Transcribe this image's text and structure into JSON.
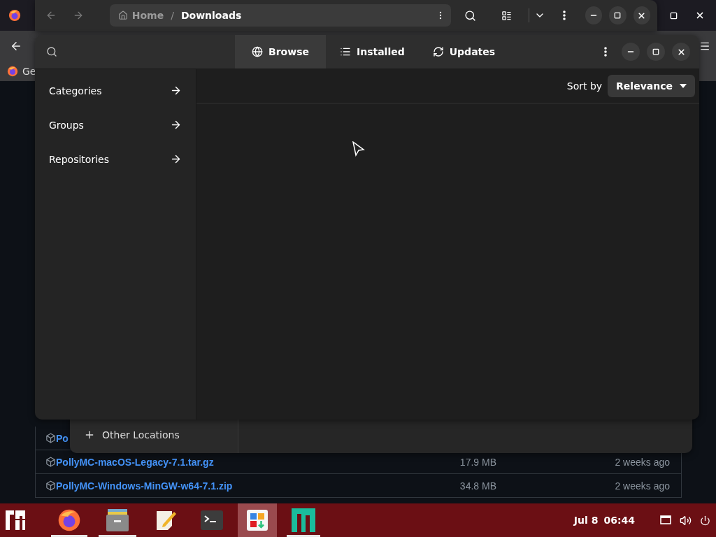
{
  "browser": {
    "tab_title": "Ge",
    "files": [
      {
        "name": "Po"
      },
      {
        "name": "PollyMC-macOS-Legacy-7.1.tar.gz",
        "size": "17.9 MB",
        "date": "2 weeks ago"
      },
      {
        "name": "PollyMC-Windows-MinGW-w64-7.1.zip",
        "size": "34.8 MB",
        "date": "2 weeks ago"
      }
    ]
  },
  "files_window": {
    "path": [
      {
        "label": "Home",
        "current": false
      },
      {
        "label": "Downloads",
        "current": true
      }
    ],
    "separator": "/",
    "sidebar_items": [
      "Other Locations"
    ]
  },
  "software_window": {
    "tabs": [
      {
        "label": "Browse",
        "kind": "globe",
        "selected": true
      },
      {
        "label": "Installed",
        "kind": "list",
        "selected": false
      },
      {
        "label": "Updates",
        "kind": "refresh",
        "selected": false
      }
    ],
    "sidebar": [
      "Categories",
      "Groups",
      "Repositories"
    ],
    "sort_label": "Sort by",
    "sort_value": "Relevance"
  },
  "taskbar": {
    "apps": [
      {
        "kind": "menu",
        "running": false,
        "selected": false
      },
      {
        "kind": "firefox",
        "running": true,
        "selected": false
      },
      {
        "kind": "files",
        "running": true,
        "selected": false
      },
      {
        "kind": "editor",
        "running": false,
        "selected": false
      },
      {
        "kind": "terminal",
        "running": false,
        "selected": false
      },
      {
        "kind": "software",
        "running": false,
        "selected": true
      },
      {
        "kind": "settings",
        "running": true,
        "selected": false
      }
    ],
    "date": "Jul 8",
    "time": "06:44"
  }
}
